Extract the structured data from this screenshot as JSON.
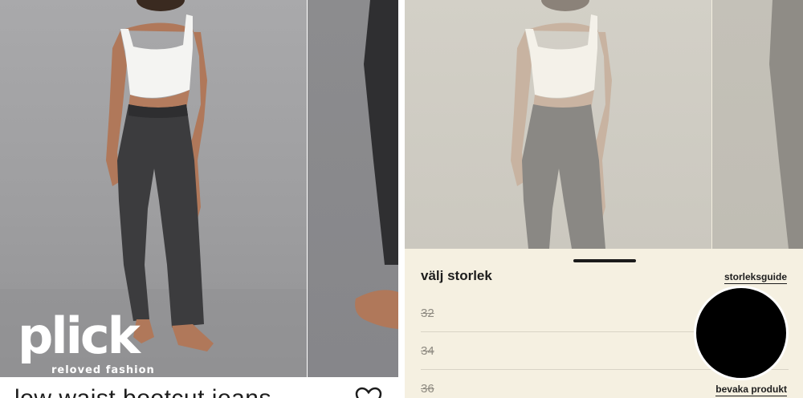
{
  "left": {
    "brand": {
      "name": "plick",
      "tagline": "reloved fashion"
    },
    "product_title": "low waist bootcut jeans",
    "favorite_icon": "heart-icon"
  },
  "right": {
    "size_sheet": {
      "title": "välj storlek",
      "size_guide_label": "storleksguide",
      "sizes": [
        {
          "label": "32",
          "available": false
        },
        {
          "label": "34",
          "available": false
        },
        {
          "label": "36",
          "available": false
        }
      ],
      "watch_label": "bevaka produkt"
    }
  },
  "colors": {
    "sheet_background": "#f5f0e1",
    "photo_background": "#a9a9ab",
    "text": "#1d1d1d"
  }
}
